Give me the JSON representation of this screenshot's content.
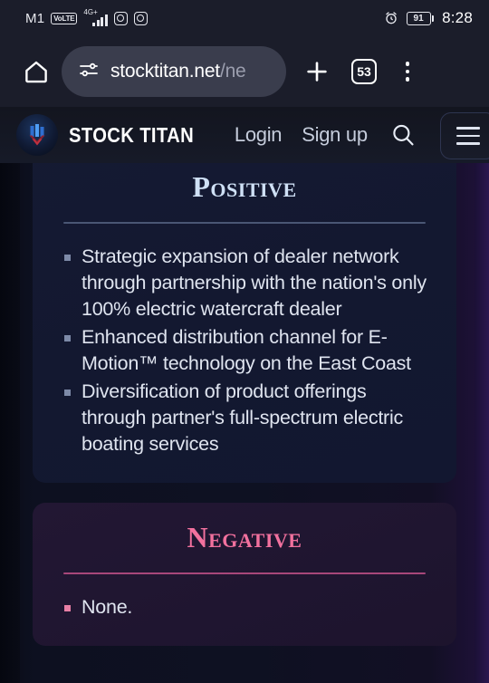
{
  "status_bar": {
    "carrier": "M1",
    "volte_badge": "VoLTE",
    "network_type": "4G+",
    "signal_bars": 4,
    "app_icons": [
      "instagram-icon",
      "instagram-icon"
    ],
    "alarm_icon": "alarm-clock-icon",
    "battery_percent": "91",
    "time": "8:28"
  },
  "browser": {
    "home_icon": "home-icon",
    "site_settings_icon": "tune-icon",
    "url_visible": "stocktitan.net",
    "url_dim": "/ne",
    "url_full": "stocktitan.net/ne",
    "new_tab_label": "+",
    "tab_count": "53",
    "menu_icon": "three-dot-menu-icon"
  },
  "site_header": {
    "logo_icon": "stock-titan-logo",
    "brand": "STOCK TITAN",
    "login_label": "Login",
    "signup_label": "Sign up",
    "search_icon": "search-icon",
    "hamburger_icon": "hamburger-menu-icon"
  },
  "content": {
    "positive_card": {
      "title": "Positive",
      "bullets": [
        "Strategic expansion of dealer network through partnership with the nation's only 100% electric watercraft dealer",
        "Enhanced distribution channel for E-Motion™ technology on the East Coast",
        "Diversification of product offerings through partner's full-spectrum electric boating services"
      ]
    },
    "negative_card": {
      "title": "Negative",
      "bullets": [
        "None."
      ]
    }
  },
  "colors": {
    "positive_title": "#cfe0f5",
    "negative_title": "#f2719e",
    "positive_divider": "#4a5674",
    "negative_divider": "#a8477a",
    "page_background": "#0e1122"
  }
}
